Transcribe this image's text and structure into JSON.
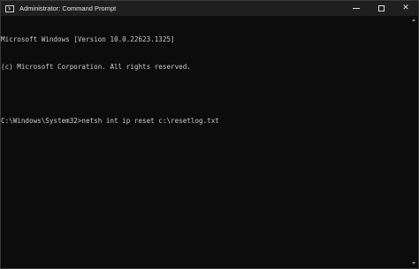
{
  "window": {
    "title": "Administrator: Command Prompt",
    "icon": "terminal-icon"
  },
  "controls": {
    "minimize_icon": "minimize-icon",
    "maximize_icon": "maximize-icon",
    "close_glyph": "✕"
  },
  "console": {
    "lines": [
      "Microsoft Windows [Version 10.0.22623.1325]",
      "(c) Microsoft Corporation. All rights reserved.",
      "",
      "C:\\Windows\\System32>netsh int ip reset c:\\resetlog.txt"
    ]
  },
  "colors": {
    "background": "#0c0c0c",
    "titlebar": "#1f1f1f",
    "text": "#cccccc"
  }
}
